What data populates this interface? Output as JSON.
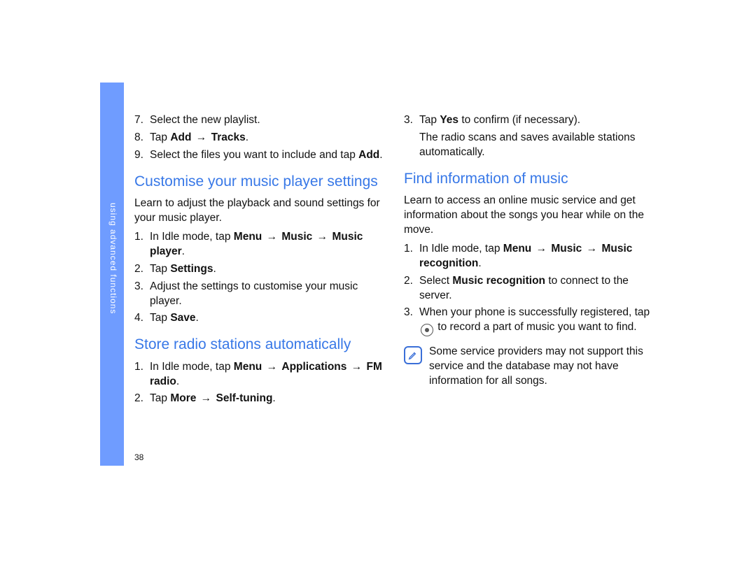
{
  "sidebar": {
    "label": "using advanced functions"
  },
  "page_number": "38",
  "col1": {
    "cont_list": [
      {
        "n": "7.",
        "text": "Select the new playlist."
      },
      {
        "n": "8.",
        "html": "Tap <b>Add</b> <span class='arrow'>→</span> <b>Tracks</b>."
      },
      {
        "n": "9.",
        "html": "Select the files you want to include and tap <b>Add</b>."
      }
    ],
    "sec1": {
      "title": "Customise your music player settings",
      "intro": "Learn to adjust the playback and sound settings for your music player.",
      "steps": [
        {
          "n": "1.",
          "html": "In Idle mode, tap <b>Menu</b> <span class='arrow'>→</span> <b>Music</b> <span class='arrow'>→</span> <b>Music player</b>."
        },
        {
          "n": "2.",
          "html": "Tap <b>Settings</b>."
        },
        {
          "n": "3.",
          "text": "Adjust the settings to customise your music player."
        },
        {
          "n": "4.",
          "html": "Tap <b>Save</b>."
        }
      ]
    },
    "sec2": {
      "title": "Store radio stations automatically",
      "steps": [
        {
          "n": "1.",
          "html": "In Idle mode, tap <b>Menu</b> <span class='arrow'>→</span> <b>Applications</b> <span class='arrow'>→</span> <b>FM radio</b>."
        },
        {
          "n": "2.",
          "html": "Tap <b>More</b> <span class='arrow'>→</span> <b>Self-tuning</b>."
        }
      ]
    }
  },
  "col2": {
    "cont_list": [
      {
        "n": "3.",
        "html": "Tap <b>Yes</b> to confirm (if necessary)."
      }
    ],
    "cont_follow": "The radio scans and saves available stations automatically.",
    "sec1": {
      "title": "Find information of music",
      "intro": "Learn to access an online music service and get information about the songs you hear while on the move.",
      "steps": [
        {
          "n": "1.",
          "html": "In Idle mode, tap <b>Menu</b> <span class='arrow'>→</span> <b>Music</b> <span class='arrow'>→</span> <b>Music recognition</b>."
        },
        {
          "n": "2.",
          "html": "Select <b>Music recognition</b> to connect to the server."
        },
        {
          "n": "3.",
          "html": "When your phone is successfully registered, tap <span class='record-icon' data-name='record-icon' data-interactable='false'></span> to record a part of music you want to find."
        }
      ],
      "note": "Some service providers may not support this service and the database may not have information for all songs."
    }
  }
}
